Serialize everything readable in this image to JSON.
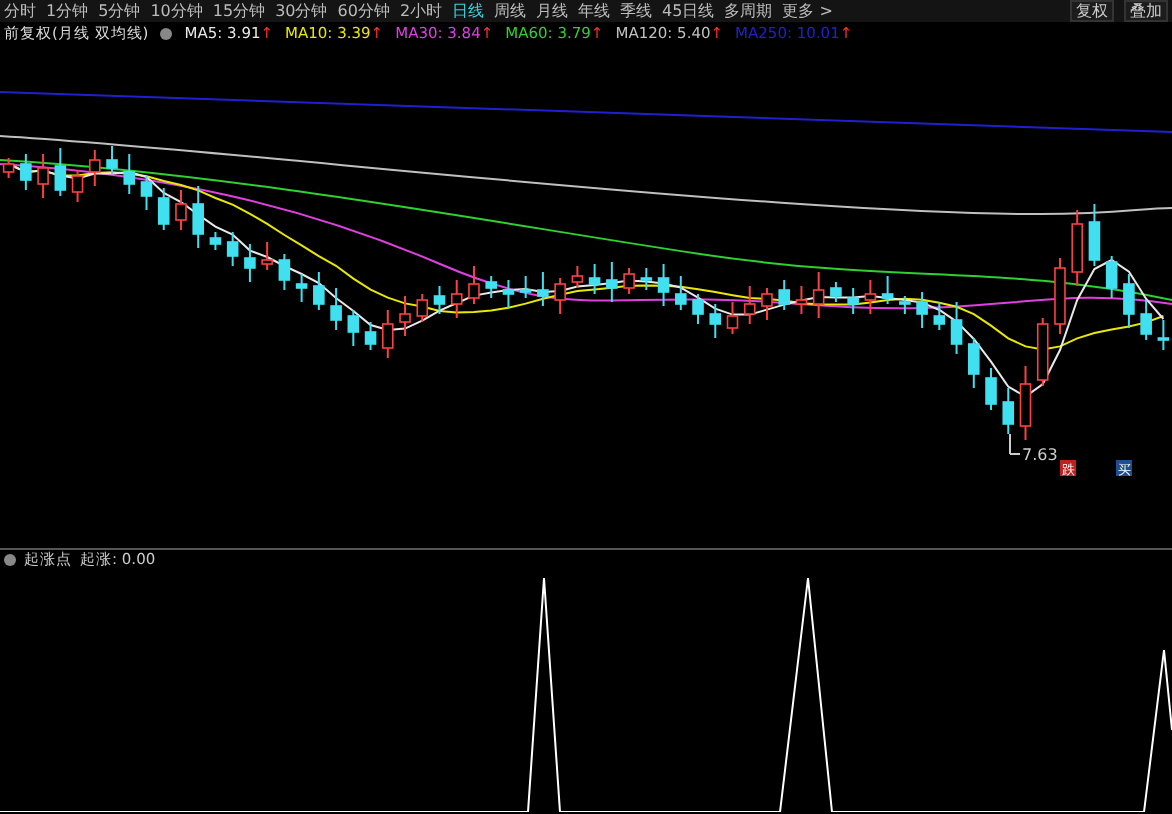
{
  "toolbar": {
    "periods": [
      {
        "label": "分时",
        "selected": false
      },
      {
        "label": "1分钟",
        "selected": false
      },
      {
        "label": "5分钟",
        "selected": false
      },
      {
        "label": "10分钟",
        "selected": false
      },
      {
        "label": "15分钟",
        "selected": false
      },
      {
        "label": "30分钟",
        "selected": false
      },
      {
        "label": "60分钟",
        "selected": false
      },
      {
        "label": "2小时",
        "selected": false
      },
      {
        "label": "日线",
        "selected": true
      },
      {
        "label": "周线",
        "selected": false
      },
      {
        "label": "月线",
        "selected": false
      },
      {
        "label": "年线",
        "selected": false
      },
      {
        "label": "季线",
        "selected": false
      },
      {
        "label": "45日线",
        "selected": false
      },
      {
        "label": "多周期",
        "selected": false
      },
      {
        "label": "更多 >",
        "selected": false
      }
    ],
    "actions": [
      "复权",
      "叠加"
    ]
  },
  "legend": {
    "title": "前复权(月线 双均线)",
    "items": [
      {
        "label": "MA5: 3.91",
        "arrow": "↑",
        "color": "#e8e8e8"
      },
      {
        "label": "MA10: 3.39",
        "arrow": "↑",
        "color": "#e8e800"
      },
      {
        "label": "MA30: 3.84",
        "arrow": "↑",
        "color": "#e040e0"
      },
      {
        "label": "MA60: 3.79",
        "arrow": "↑",
        "color": "#30d030"
      },
      {
        "label": "MA120: 5.40",
        "arrow": "↑",
        "color": "#c0c0c0"
      },
      {
        "label": "MA250: 10.01",
        "arrow": "↑",
        "color": "#2020d0"
      }
    ]
  },
  "price_chart": {
    "low_label": "7.63",
    "signals": [
      {
        "label": "跌",
        "kind": "sell"
      },
      {
        "label": "买",
        "kind": "buy"
      }
    ]
  },
  "indicator": {
    "name": "起涨点",
    "reading": "起涨: 0.00"
  }
}
